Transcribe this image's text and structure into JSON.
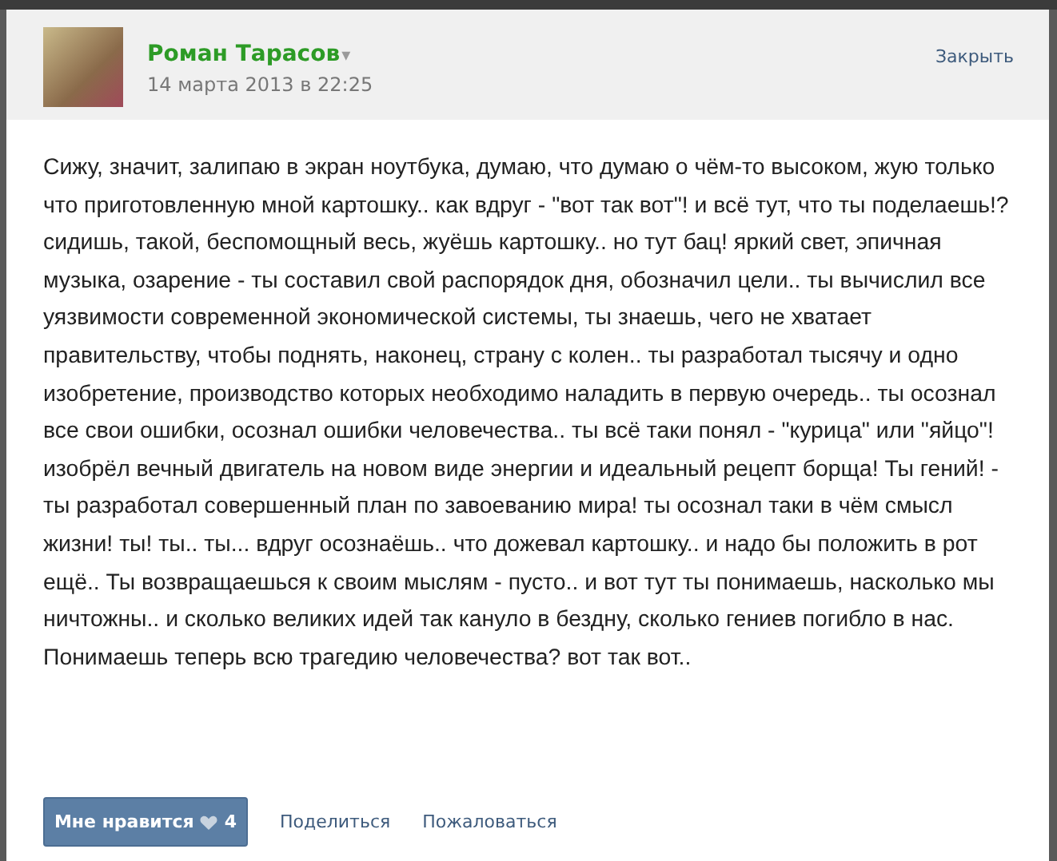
{
  "post": {
    "author": "Роман Тарасов",
    "author_menu": "▾",
    "date": "14 марта 2013 в 22:25",
    "close": "Закрыть",
    "text": "Сижу, значит, залипаю в экран ноутбука, думаю, что думаю о чём-то высоком, жую только что приготовленную мной картошку.. как вдруг - \"вот так вот\"! и всё тут, что ты поделаешь!? сидишь, такой, беспомощный весь, жуёшь картошку.. но тут бац! яркий свет, эпичная музыка, озарение - ты составил свой распорядок дня, обозначил цели.. ты вычислил все уязвимости современной экономической системы, ты знаешь, чего не хватает правительству, чтобы поднять, наконец, страну с колен.. ты разработал тысячу и одно изобретение, производство которых необходимо наладить в первую очередь.. ты осознал все свои ошибки, осознал ошибки человечества.. ты всё таки понял - \"курица\" или \"яйцо\"! изобрёл вечный двигатель на новом виде энергии и идеальный рецепт борща! Ты гений! - ты разработал совершенный план по завоеванию мира! ты осознал таки в чём смысл жизни! ты! ты.. ты... вдруг осознаёшь.. что дожевал картошку.. и надо бы положить в рот ещё.. Ты возвращаешься к своим мыслям - пусто.. и вот тут ты понимаешь, насколько мы ничтожны.. и сколько великих идей так кануло в бездну, сколько гениев погибло в нас. Понимаешь теперь всю трагедию человечества? вот так вот..",
    "like": {
      "label": "Мне нравится",
      "count": "4"
    },
    "actions": [
      "Поделиться",
      "Пожаловаться"
    ]
  }
}
